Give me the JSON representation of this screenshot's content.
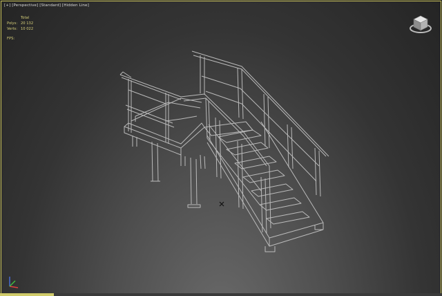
{
  "viewport": {
    "label_parts": [
      "[+]",
      "[Perspective]",
      "[Standard]",
      "[Hidden Line]"
    ]
  },
  "stats": {
    "header": "Total",
    "polys_label": "Polys:",
    "polys_value": "20 132",
    "verts_label": "Verts:",
    "verts_value": "10 022",
    "fps_label": "FPS:"
  },
  "colors": {
    "frame_border": "#c9c25a",
    "stats_text": "#d8d07a",
    "wireframe": "#c8c8c8",
    "axis_x": "#e04040",
    "axis_y": "#40c040",
    "axis_z": "#4a6fe0"
  },
  "icons": {
    "viewcube": "viewcube-icon",
    "axis": "axis-tripod-icon",
    "pivot": "pivot-cross-icon"
  }
}
